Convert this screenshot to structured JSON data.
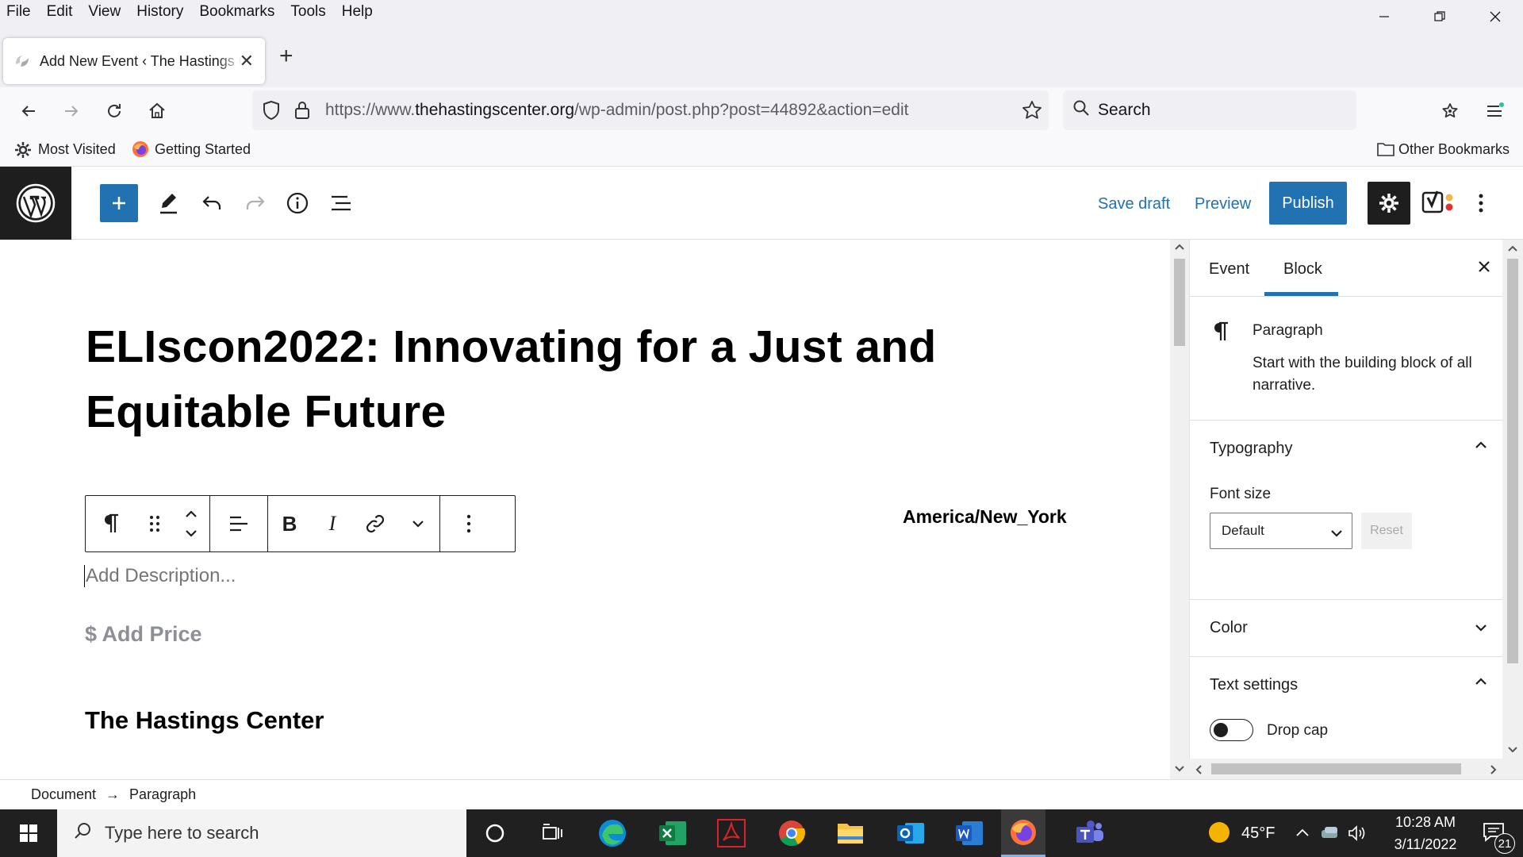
{
  "menubar": {
    "items": [
      "File",
      "Edit",
      "View",
      "History",
      "Bookmarks",
      "Tools",
      "Help"
    ]
  },
  "tab": {
    "title": "Add New Event ‹ The Hastings Center — WordPress"
  },
  "urlbar": {
    "prefix": "https://www.",
    "domain": "thehastingscenter.org",
    "path": "/wp-admin/post.php?post=44892&action=edit"
  },
  "searchbar": {
    "placeholder": "Search"
  },
  "bookmarks": {
    "most_visited": "Most Visited",
    "getting_started": "Getting Started",
    "other": "Other Bookmarks"
  },
  "wptoolbar": {
    "save_draft": "Save draft",
    "preview": "Preview",
    "publish": "Publish"
  },
  "editor": {
    "title": "ELIscon2022: Innovating for a Just and Equitable Future",
    "timezone": "America/New_York",
    "description_placeholder": "Add Description...",
    "price_placeholder": "$ Add Price",
    "venue": "The Hastings Center"
  },
  "sidebar": {
    "tabs": [
      "Event",
      "Block"
    ],
    "active_tab": "Block",
    "block_name": "Paragraph",
    "block_desc": "Start with the building block of all narrative.",
    "typography": "Typography",
    "font_size_label": "Font size",
    "font_size_value": "Default",
    "reset": "Reset",
    "color": "Color",
    "text_settings": "Text settings",
    "drop_cap": "Drop cap"
  },
  "footer": {
    "crumb_root": "Document",
    "arrow": "→",
    "crumb_leaf": "Paragraph"
  },
  "taskbar": {
    "search_placeholder": "Type here to search",
    "weather": "45°F",
    "time": "10:28 AM",
    "date": "3/11/2022",
    "notifications": "21"
  },
  "colors": {
    "wp_blue": "#2271b1",
    "wp_dark": "#1e1e1e"
  }
}
